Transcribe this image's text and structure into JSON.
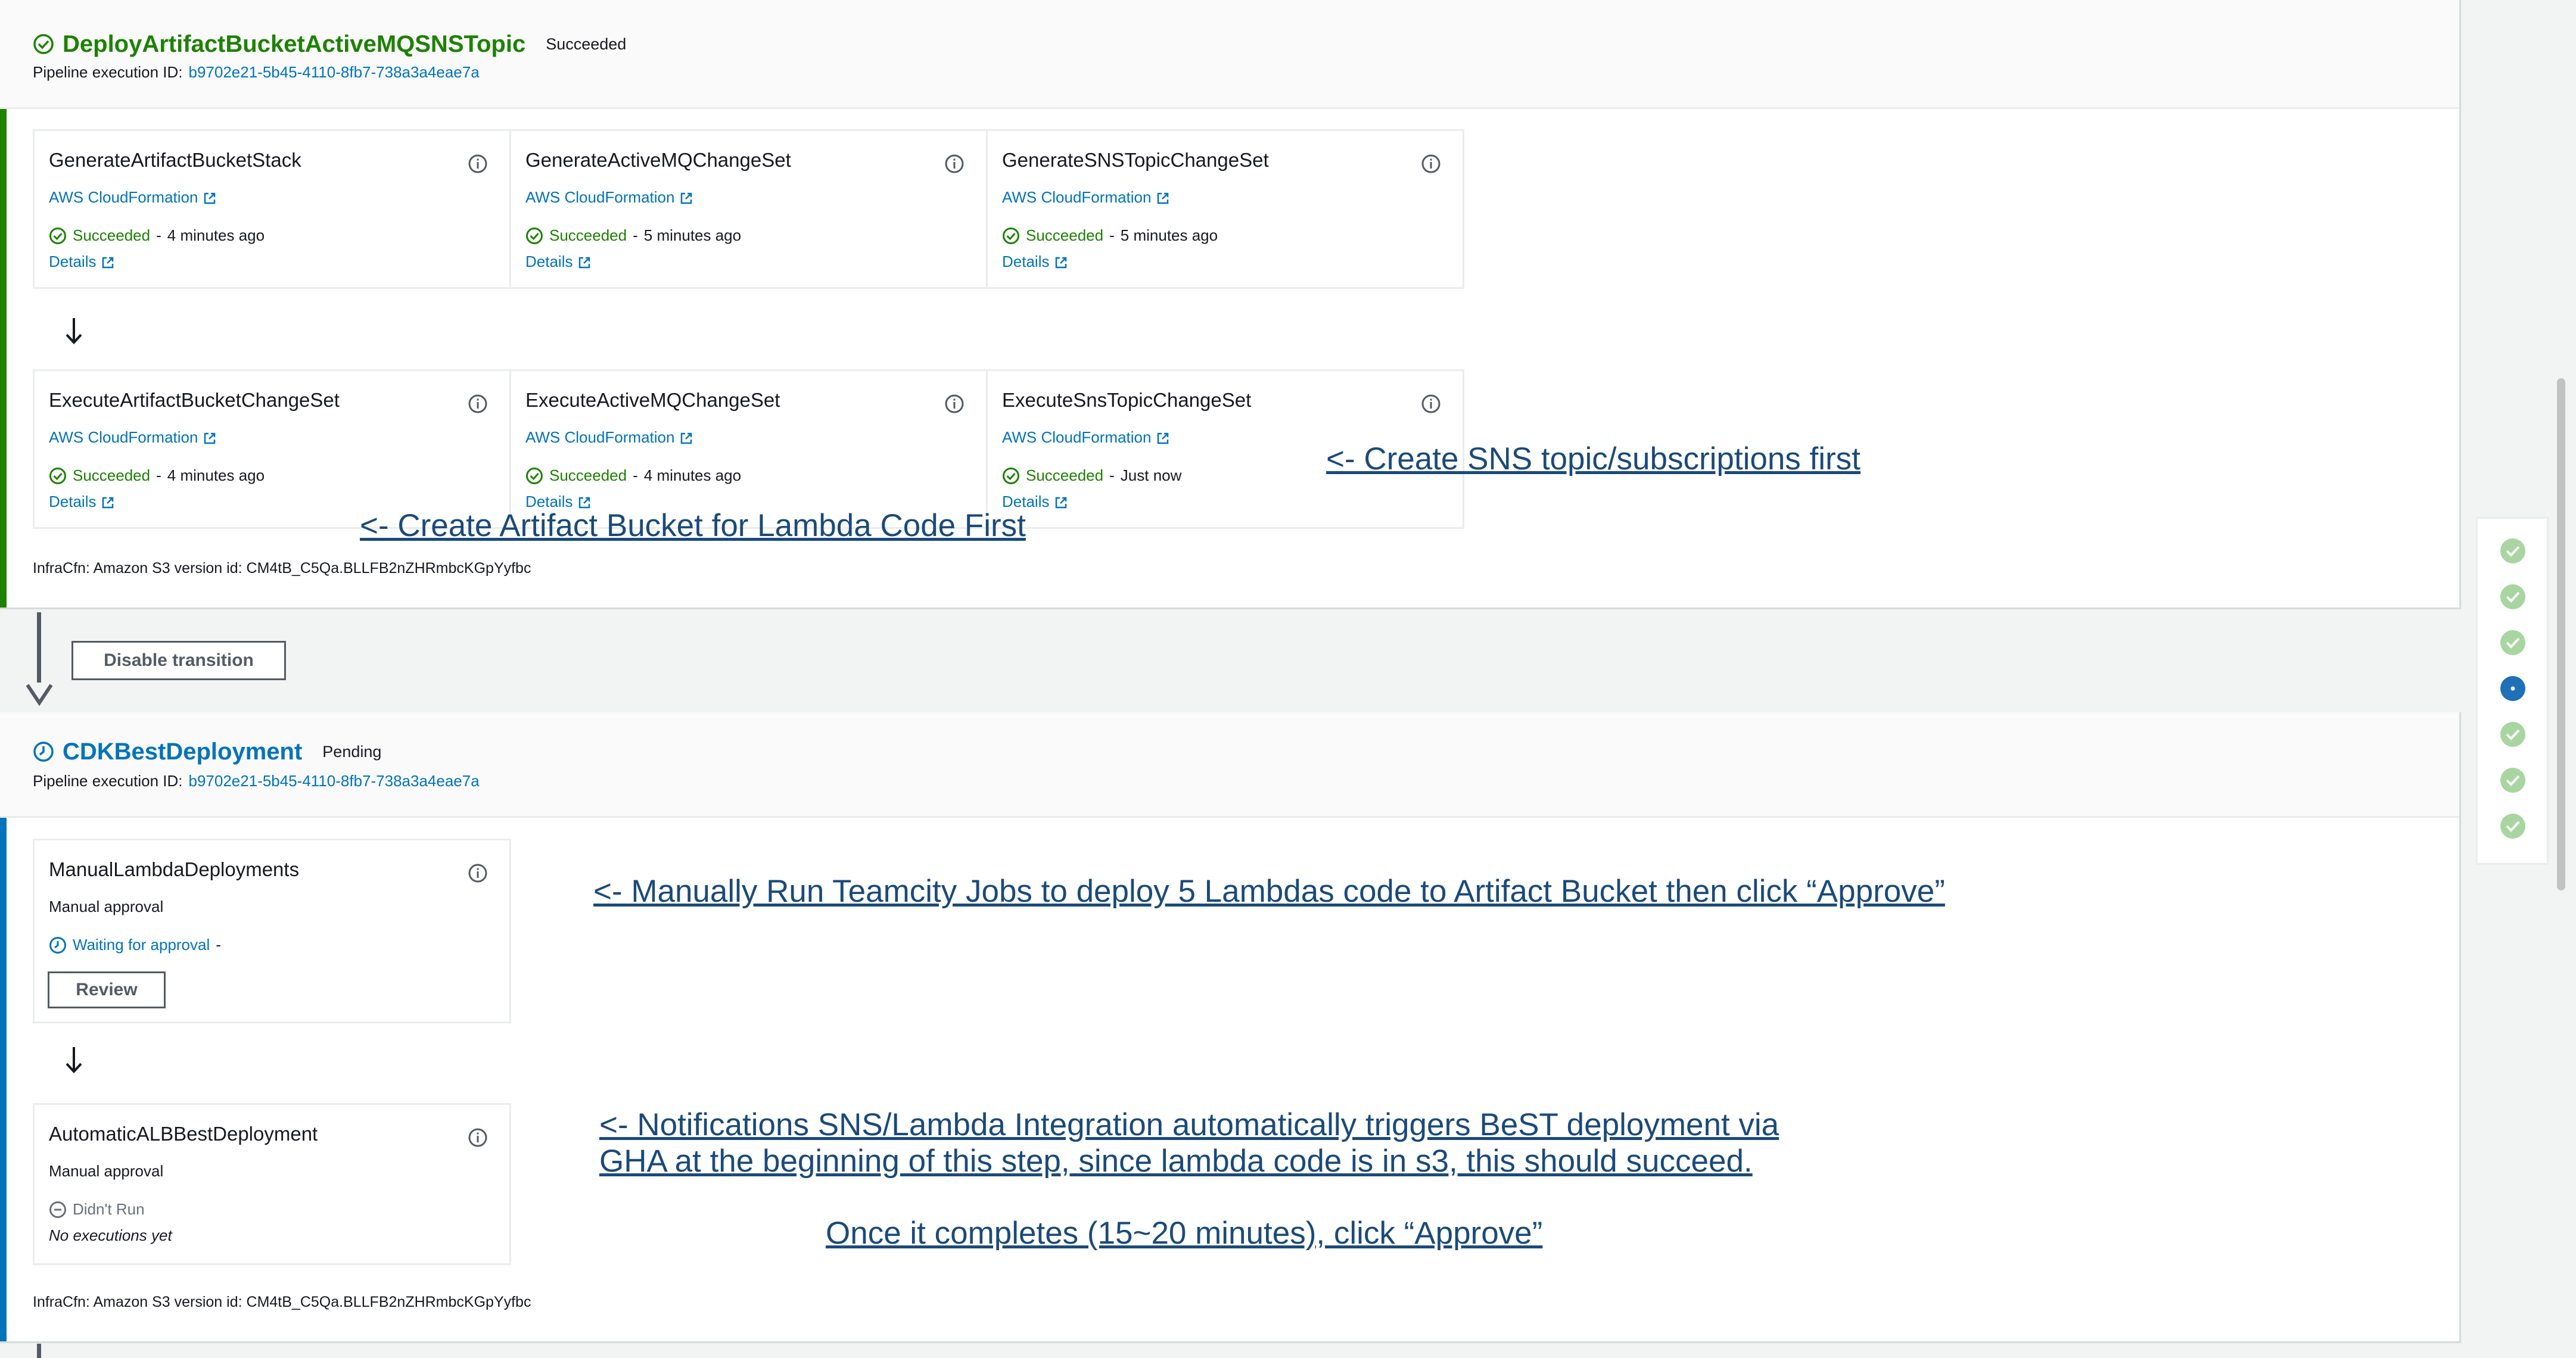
{
  "stage1": {
    "name": "DeployArtifactBucketActiveMQSNSTopic",
    "status": "Succeeded",
    "pipeline_label": "Pipeline execution ID:",
    "pipeline_id": "b9702e21-5b45-4110-8fb7-738a3a4eae7a",
    "infra": "InfraCfn: Amazon S3 version id: CM4tB_C5Qa.BLLFB2nZHRmbcKGpYyfbc",
    "row1": [
      {
        "name": "GenerateArtifactBucketStack",
        "provider": "AWS CloudFormation",
        "status": "Succeeded",
        "time": "4 minutes ago",
        "details": "Details"
      },
      {
        "name": "GenerateActiveMQChangeSet",
        "provider": "AWS CloudFormation",
        "status": "Succeeded",
        "time": "5 minutes ago",
        "details": "Details"
      },
      {
        "name": "GenerateSNSTopicChangeSet",
        "provider": "AWS CloudFormation",
        "status": "Succeeded",
        "time": "5 minutes ago",
        "details": "Details"
      }
    ],
    "row2": [
      {
        "name": "ExecuteArtifactBucketChangeSet",
        "provider": "AWS CloudFormation",
        "status": "Succeeded",
        "time": "4 minutes ago",
        "details": "Details"
      },
      {
        "name": "ExecuteActiveMQChangeSet",
        "provider": "AWS CloudFormation",
        "status": "Succeeded",
        "time": "4 minutes ago",
        "details": "Details"
      },
      {
        "name": "ExecuteSnsTopicChangeSet",
        "provider": "AWS CloudFormation",
        "status": "Succeeded",
        "time": "Just now",
        "details": "Details"
      }
    ]
  },
  "transition": {
    "button": "Disable transition"
  },
  "stage2": {
    "name": "CDKBestDeployment",
    "status": "Pending",
    "pipeline_label": "Pipeline execution ID:",
    "pipeline_id": "b9702e21-5b45-4110-8fb7-738a3a4eae7a",
    "infra": "InfraCfn: Amazon S3 version id: CM4tB_C5Qa.BLLFB2nZHRmbcKGpYyfbc",
    "manual": {
      "name": "ManualLambdaDeployments",
      "type": "Manual approval",
      "status": "Waiting for approval",
      "dash": "-",
      "button": "Review"
    },
    "auto": {
      "name": "AutomaticALBBestDeployment",
      "type": "Manual approval",
      "status": "Didn't Run",
      "sub": "No executions yet"
    }
  },
  "annotations": {
    "sns": "<- Create SNS topic/subscriptions first",
    "bucket": "<- Create Artifact Bucket for Lambda Code First",
    "manual": "<- Manually Run Teamcity Jobs to deploy 5 Lambdas code to Artifact Bucket then click “Approve”",
    "notify_line1": "<- Notifications SNS/Lambda Integration automatically triggers BeST deployment via",
    "notify_line2": "GHA at the beginning of this step, since lambda code is in s3, this should succeed.",
    "notify_line3": "Once it completes (15~20 minutes), click “Approve”"
  },
  "colors": {
    "success": "#1d8102",
    "pending": "#0073bb",
    "link": "#0073bb",
    "annotation": "#1a4a7a",
    "muted": "#687078"
  },
  "side_steps": [
    "success",
    "success",
    "success",
    "in-progress",
    "success",
    "success",
    "success"
  ]
}
